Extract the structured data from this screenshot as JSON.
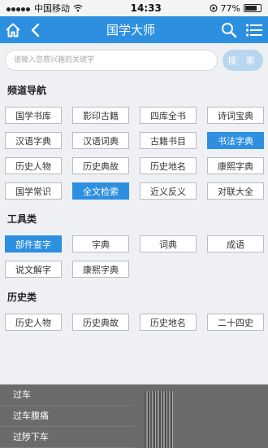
{
  "status": {
    "carrier": "中国移动",
    "time": "14:33",
    "battery": "77%",
    "battery_level": 0.77
  },
  "navbar": {
    "title": "国学大师"
  },
  "search": {
    "placeholder": "请输入您感兴趣的关键字",
    "button": "搜 索"
  },
  "sections": [
    {
      "title": "频道导航",
      "items": [
        {
          "label": "国学书库"
        },
        {
          "label": "影印古籍"
        },
        {
          "label": "四库全书"
        },
        {
          "label": "诗词宝典"
        },
        {
          "label": "汉语字典"
        },
        {
          "label": "汉语词典"
        },
        {
          "label": "古籍书目"
        },
        {
          "label": "书法字典",
          "active": true
        },
        {
          "label": "历史人物"
        },
        {
          "label": "历史典故"
        },
        {
          "label": "历史地名"
        },
        {
          "label": "康熙字典"
        },
        {
          "label": "国学常识"
        },
        {
          "label": "全文检索",
          "active": true
        },
        {
          "label": "近义反义"
        },
        {
          "label": "对联大全"
        }
      ]
    },
    {
      "title": "工具类",
      "items": [
        {
          "label": "部件查字",
          "active": true
        },
        {
          "label": "字典"
        },
        {
          "label": "词典"
        },
        {
          "label": "成语"
        },
        {
          "label": "说文解字"
        },
        {
          "label": "康熙字典"
        }
      ]
    },
    {
      "title": "历史类",
      "items": [
        {
          "label": "历史人物"
        },
        {
          "label": "历史典故"
        },
        {
          "label": "历史地名"
        },
        {
          "label": "二十四史"
        }
      ]
    }
  ],
  "overlay": {
    "items": [
      "过车",
      "过车腹痛",
      "过陟下车"
    ]
  },
  "colors": {
    "accent": "#2d8fe0",
    "background": "#eef0f3"
  }
}
